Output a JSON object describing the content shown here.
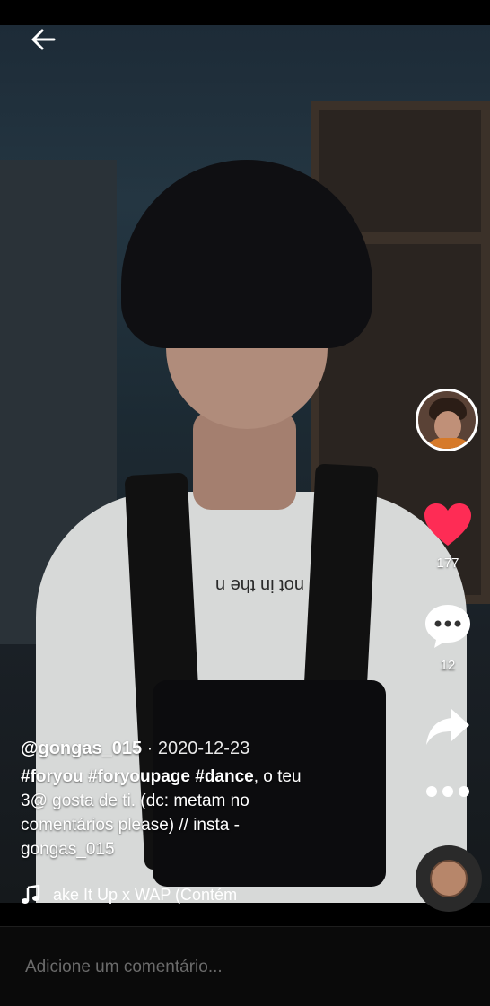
{
  "video": {
    "shirt_print": "not in the n"
  },
  "header": {
    "back_icon": "arrow-left-icon"
  },
  "sidebar": {
    "avatar_icon": "profile-avatar-icon",
    "like": {
      "icon": "heart-icon",
      "color": "#fe2c55",
      "count": "177"
    },
    "comment": {
      "icon": "comment-bubble-icon",
      "count": "12"
    },
    "share": {
      "icon": "share-arrow-icon"
    },
    "more": {
      "icon": "more-dots-icon"
    }
  },
  "caption": {
    "username": "@gongas_015",
    "separator": " · ",
    "date": "2020-12-23",
    "hashtags": "#foryou #foryoupage #dance",
    "text": ", o teu 3@ gosta de ti. (dc: metam no comentários please) // insta - gongas_015"
  },
  "music": {
    "icon": "music-note-icon",
    "title": "ake It Up x WAP (Contém"
  },
  "comment_input": {
    "placeholder": "Adicione um comentário..."
  }
}
